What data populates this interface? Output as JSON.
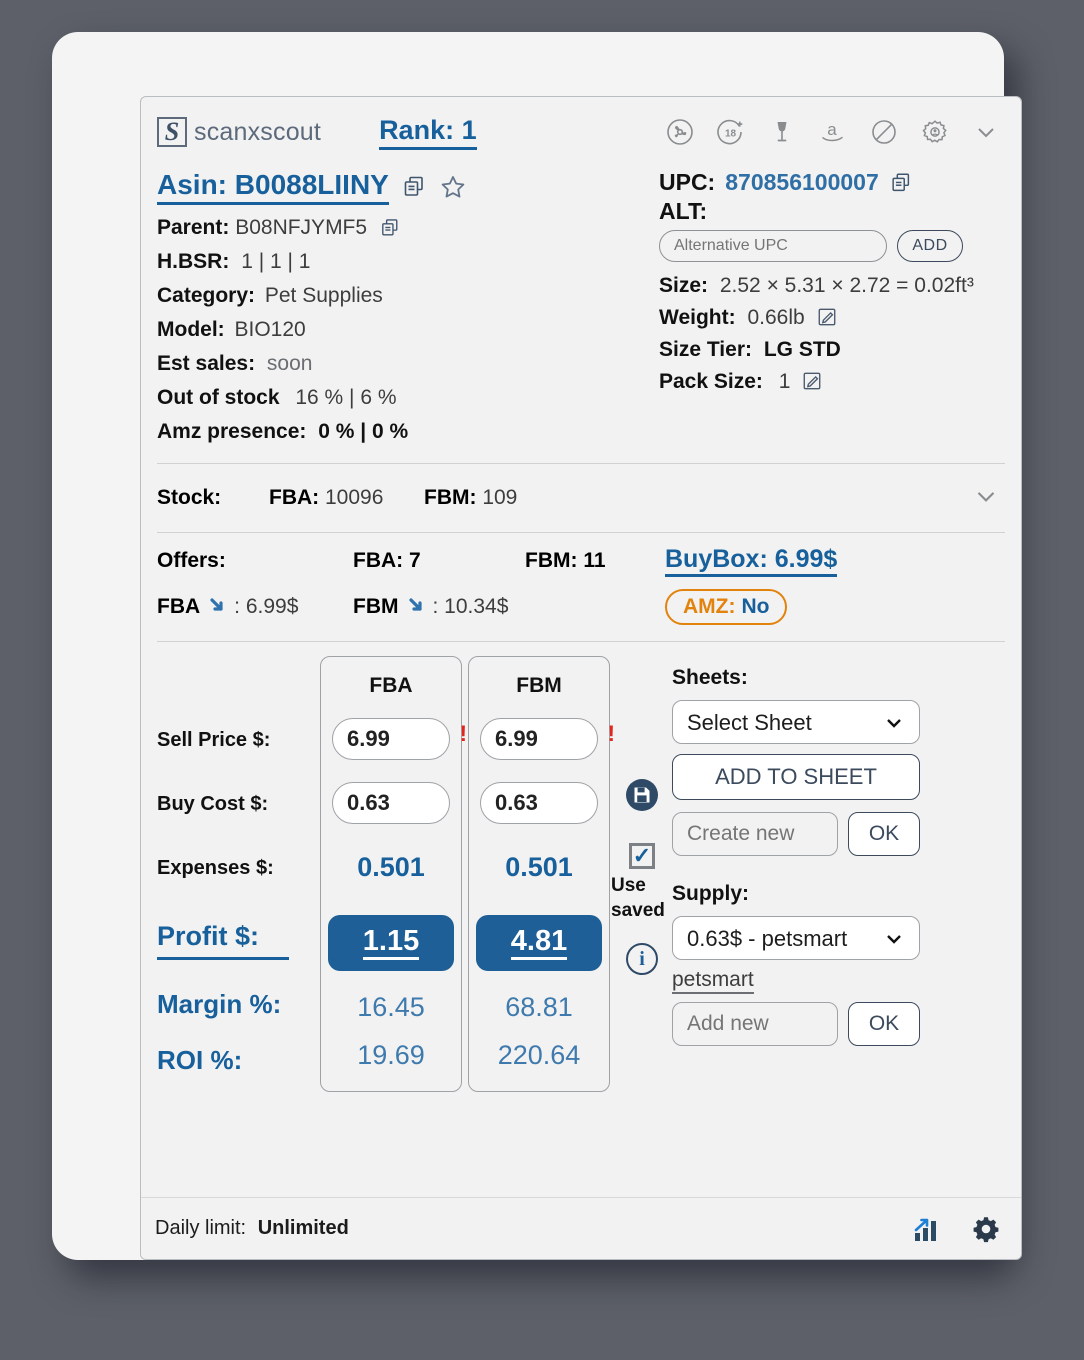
{
  "brand": {
    "name": "scanxscout",
    "logo_glyph": "S"
  },
  "header": {
    "rank_label": "Rank: 1",
    "icons": [
      {
        "name": "hazmat-icon"
      },
      {
        "name": "age-18-plus-icon",
        "label": "18"
      },
      {
        "name": "fragile-glass-icon"
      },
      {
        "name": "amazon-icon",
        "label": "a"
      },
      {
        "name": "prohibited-icon"
      },
      {
        "name": "settings-gear-icon"
      },
      {
        "name": "chevron-down-icon"
      }
    ]
  },
  "product": {
    "asin_label": "Asin: B0088LIINY",
    "parent_label": "Parent:",
    "parent_value": "B08NFJYMF5",
    "hbsr_label": "H.BSR:",
    "hbsr_value": "1 | 1 | 1",
    "category_label": "Category:",
    "category_value": "Pet Supplies",
    "model_label": "Model:",
    "model_value": "BIO120",
    "est_sales_label": "Est sales:",
    "est_sales_value": "soon",
    "out_of_stock_label": "Out of stock",
    "out_of_stock_value": "16 % | 6 %",
    "amz_presence_label": "Amz presence:",
    "amz_presence_value": "0 % | 0 %"
  },
  "identity": {
    "upc_label": "UPC:",
    "upc_value": "870856100007",
    "alt_label": "ALT:",
    "alt_placeholder": "Alternative UPC",
    "alt_value": "",
    "add_button": "ADD",
    "size_label": "Size:",
    "size_value": "2.52 × 5.31 × 2.72 = 0.02ft³",
    "weight_label": "Weight:",
    "weight_value": "0.66lb",
    "size_tier_label": "Size Tier:",
    "size_tier_value": "LG STD",
    "pack_size_label": "Pack Size:",
    "pack_size_value": "1"
  },
  "stock": {
    "label": "Stock:",
    "fba_label": "FBA:",
    "fba_value": "10096",
    "fbm_label": "FBM:",
    "fbm_value": "109"
  },
  "offers": {
    "label": "Offers:",
    "fba_label": "FBA: 7",
    "fbm_label": "FBM: 11",
    "buybox_label": "BuyBox: 6.99$",
    "fba_price_label": "FBA",
    "fba_price_value": ": 6.99$",
    "fbm_price_label": "FBM",
    "fbm_price_value": ": 10.34$",
    "amz_key": "AMZ:",
    "amz_value": "No"
  },
  "calculator": {
    "labels": {
      "sell_price": "Sell Price $:",
      "buy_cost": "Buy Cost $:",
      "expenses": "Expenses $:",
      "profit": "Profit $:",
      "margin": "Margin %:",
      "roi": "ROI %:"
    },
    "columns": [
      {
        "head": "FBA",
        "sell_price": "6.99",
        "buy_cost": "0.63",
        "expenses": "0.501",
        "profit": "1.15",
        "margin": "16.45",
        "roi": "19.69",
        "warning": "!"
      },
      {
        "head": "FBM",
        "sell_price": "6.99",
        "buy_cost": "0.63",
        "expenses": "0.501",
        "profit": "4.81",
        "margin": "68.81",
        "roi": "220.64",
        "warning": "!"
      }
    ]
  },
  "side": {
    "use_saved_label": "Use saved",
    "checkbox_checked": true,
    "sheets_title": "Sheets:",
    "sheet_select_value": "Select Sheet",
    "add_to_sheet_label": "ADD TO SHEET",
    "create_new_placeholder": "Create new",
    "create_new_value": "",
    "ok_label_sheets": "OK",
    "supply_title": "Supply:",
    "supply_select_value": "0.63$ - petsmart",
    "supplier_link": "petsmart",
    "add_new_placeholder": "Add new",
    "add_new_value": "",
    "ok_label_supply": "OK"
  },
  "footer": {
    "daily_limit_label": "Daily limit:",
    "daily_limit_value": "Unlimited"
  },
  "colors": {
    "accent_blue": "#17609c",
    "profit_bg": "#1d5f96",
    "amz_orange": "#e2830d",
    "warning_red": "#e3261d",
    "page_bg": "#5d6068"
  }
}
